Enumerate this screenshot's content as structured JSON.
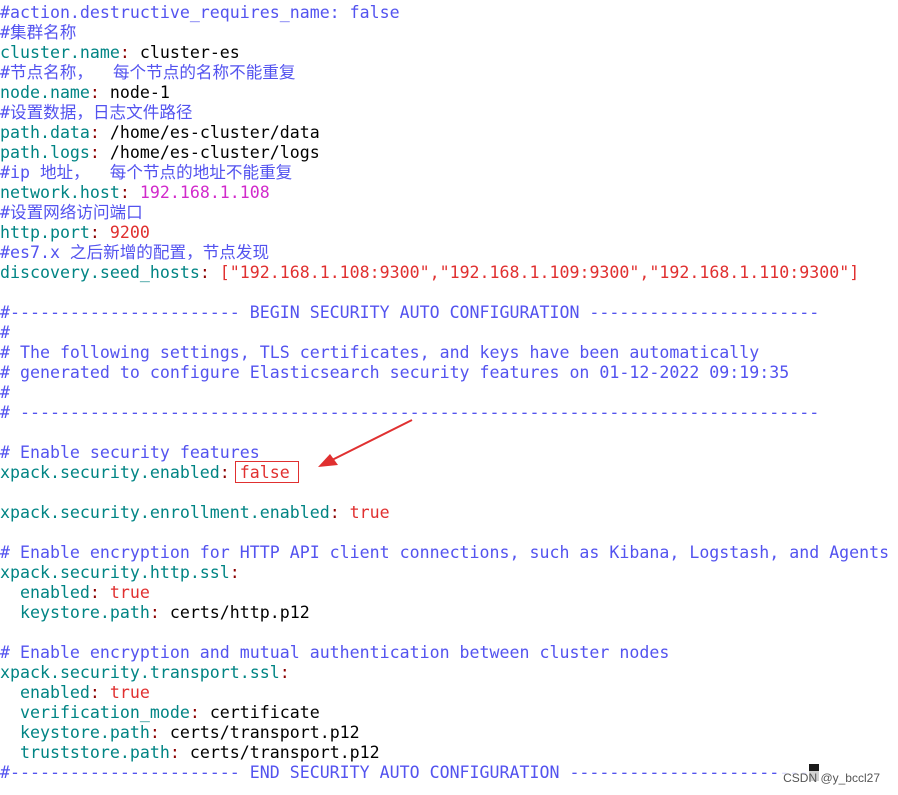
{
  "editor": {
    "lines": [
      {
        "type": "comment",
        "text": "#action.destructive_requires_name: false"
      },
      {
        "type": "comment",
        "text": "#集群名称"
      },
      {
        "type": "kv",
        "key": "cluster.name",
        "sep": ":",
        "value": " cluster-es",
        "vclass": "val"
      },
      {
        "type": "comment",
        "text": "#节点名称，  每个节点的名称不能重复"
      },
      {
        "type": "kv",
        "key": "node.name",
        "sep": ":",
        "value": " node-1",
        "vclass": "val"
      },
      {
        "type": "comment",
        "text": "#设置数据，日志文件路径"
      },
      {
        "type": "kv",
        "key": "path.data",
        "sep": ":",
        "value": " /home/es-cluster/data",
        "vclass": "val"
      },
      {
        "type": "kv",
        "key": "path.logs",
        "sep": ":",
        "value": " /home/es-cluster/logs",
        "vclass": "val"
      },
      {
        "type": "comment",
        "text": "#ip 地址，  每个节点的地址不能重复"
      },
      {
        "type": "kv",
        "key": "network.host",
        "sep": ":",
        "value": " 192.168.1.108",
        "vclass": "ip"
      },
      {
        "type": "comment",
        "text": "#设置网络访问端口"
      },
      {
        "type": "kv",
        "key": "http.port",
        "sep": ":",
        "value": " 9200",
        "vclass": "num"
      },
      {
        "type": "comment",
        "text": "#es7.x 之后新增的配置，节点发现"
      },
      {
        "type": "kv",
        "key": "discovery.seed_hosts",
        "sep": ":",
        "value": " [\"192.168.1.108:9300\",\"192.168.1.109:9300\",\"192.168.1.110:9300\"]",
        "vclass": "str"
      },
      {
        "type": "blank",
        "text": ""
      },
      {
        "type": "comment",
        "text": "#----------------------- BEGIN SECURITY AUTO CONFIGURATION -----------------------"
      },
      {
        "type": "comment",
        "text": "#"
      },
      {
        "type": "comment",
        "text": "# The following settings, TLS certificates, and keys have been automatically"
      },
      {
        "type": "comment",
        "text": "# generated to configure Elasticsearch security features on 01-12-2022 09:19:35"
      },
      {
        "type": "comment",
        "text": "#"
      },
      {
        "type": "comment",
        "text": "# --------------------------------------------------------------------------------"
      },
      {
        "type": "blank",
        "text": ""
      },
      {
        "type": "comment",
        "text": "# Enable security features"
      },
      {
        "type": "kv",
        "key": "xpack.security.enabled",
        "sep": ":",
        "value": " false",
        "vclass": "bool"
      },
      {
        "type": "blank",
        "text": ""
      },
      {
        "type": "kv",
        "key": "xpack.security.enrollment.enabled",
        "sep": ":",
        "value": " true",
        "vclass": "bool"
      },
      {
        "type": "blank",
        "text": ""
      },
      {
        "type": "comment",
        "text": "# Enable encryption for HTTP API client connections, such as Kibana, Logstash, and Agents"
      },
      {
        "type": "kv",
        "key": "xpack.security.http.ssl",
        "sep": ":",
        "value": "",
        "vclass": "val"
      },
      {
        "type": "kv",
        "key": "  enabled",
        "sep": ":",
        "value": " true",
        "vclass": "bool"
      },
      {
        "type": "kv",
        "key": "  keystore.path",
        "sep": ":",
        "value": " certs/http.p12",
        "vclass": "val"
      },
      {
        "type": "blank",
        "text": ""
      },
      {
        "type": "comment",
        "text": "# Enable encryption and mutual authentication between cluster nodes"
      },
      {
        "type": "kv",
        "key": "xpack.security.transport.ssl",
        "sep": ":",
        "value": "",
        "vclass": "val"
      },
      {
        "type": "kv",
        "key": "  enabled",
        "sep": ":",
        "value": " true",
        "vclass": "bool"
      },
      {
        "type": "kv",
        "key": "  verification_mode",
        "sep": ":",
        "value": " certificate",
        "vclass": "val"
      },
      {
        "type": "kv",
        "key": "  keystore.path",
        "sep": ":",
        "value": " certs/transport.p12",
        "vclass": "val"
      },
      {
        "type": "kv",
        "key": "  truststore.path",
        "sep": ":",
        "value": " certs/transport.p12",
        "vclass": "val"
      },
      {
        "type": "comment",
        "text": "#----------------------- END SECURITY AUTO CONFIGURATION -------------------------"
      }
    ]
  },
  "annotation": {
    "box_color": "#e03030",
    "arrow_color": "#e03030"
  },
  "watermark": {
    "text": "CSDN @y_bccl27"
  },
  "colors": {
    "comment": "#5353ef",
    "key": "#008484",
    "bool": "#e03030",
    "ip": "#d12acb"
  }
}
